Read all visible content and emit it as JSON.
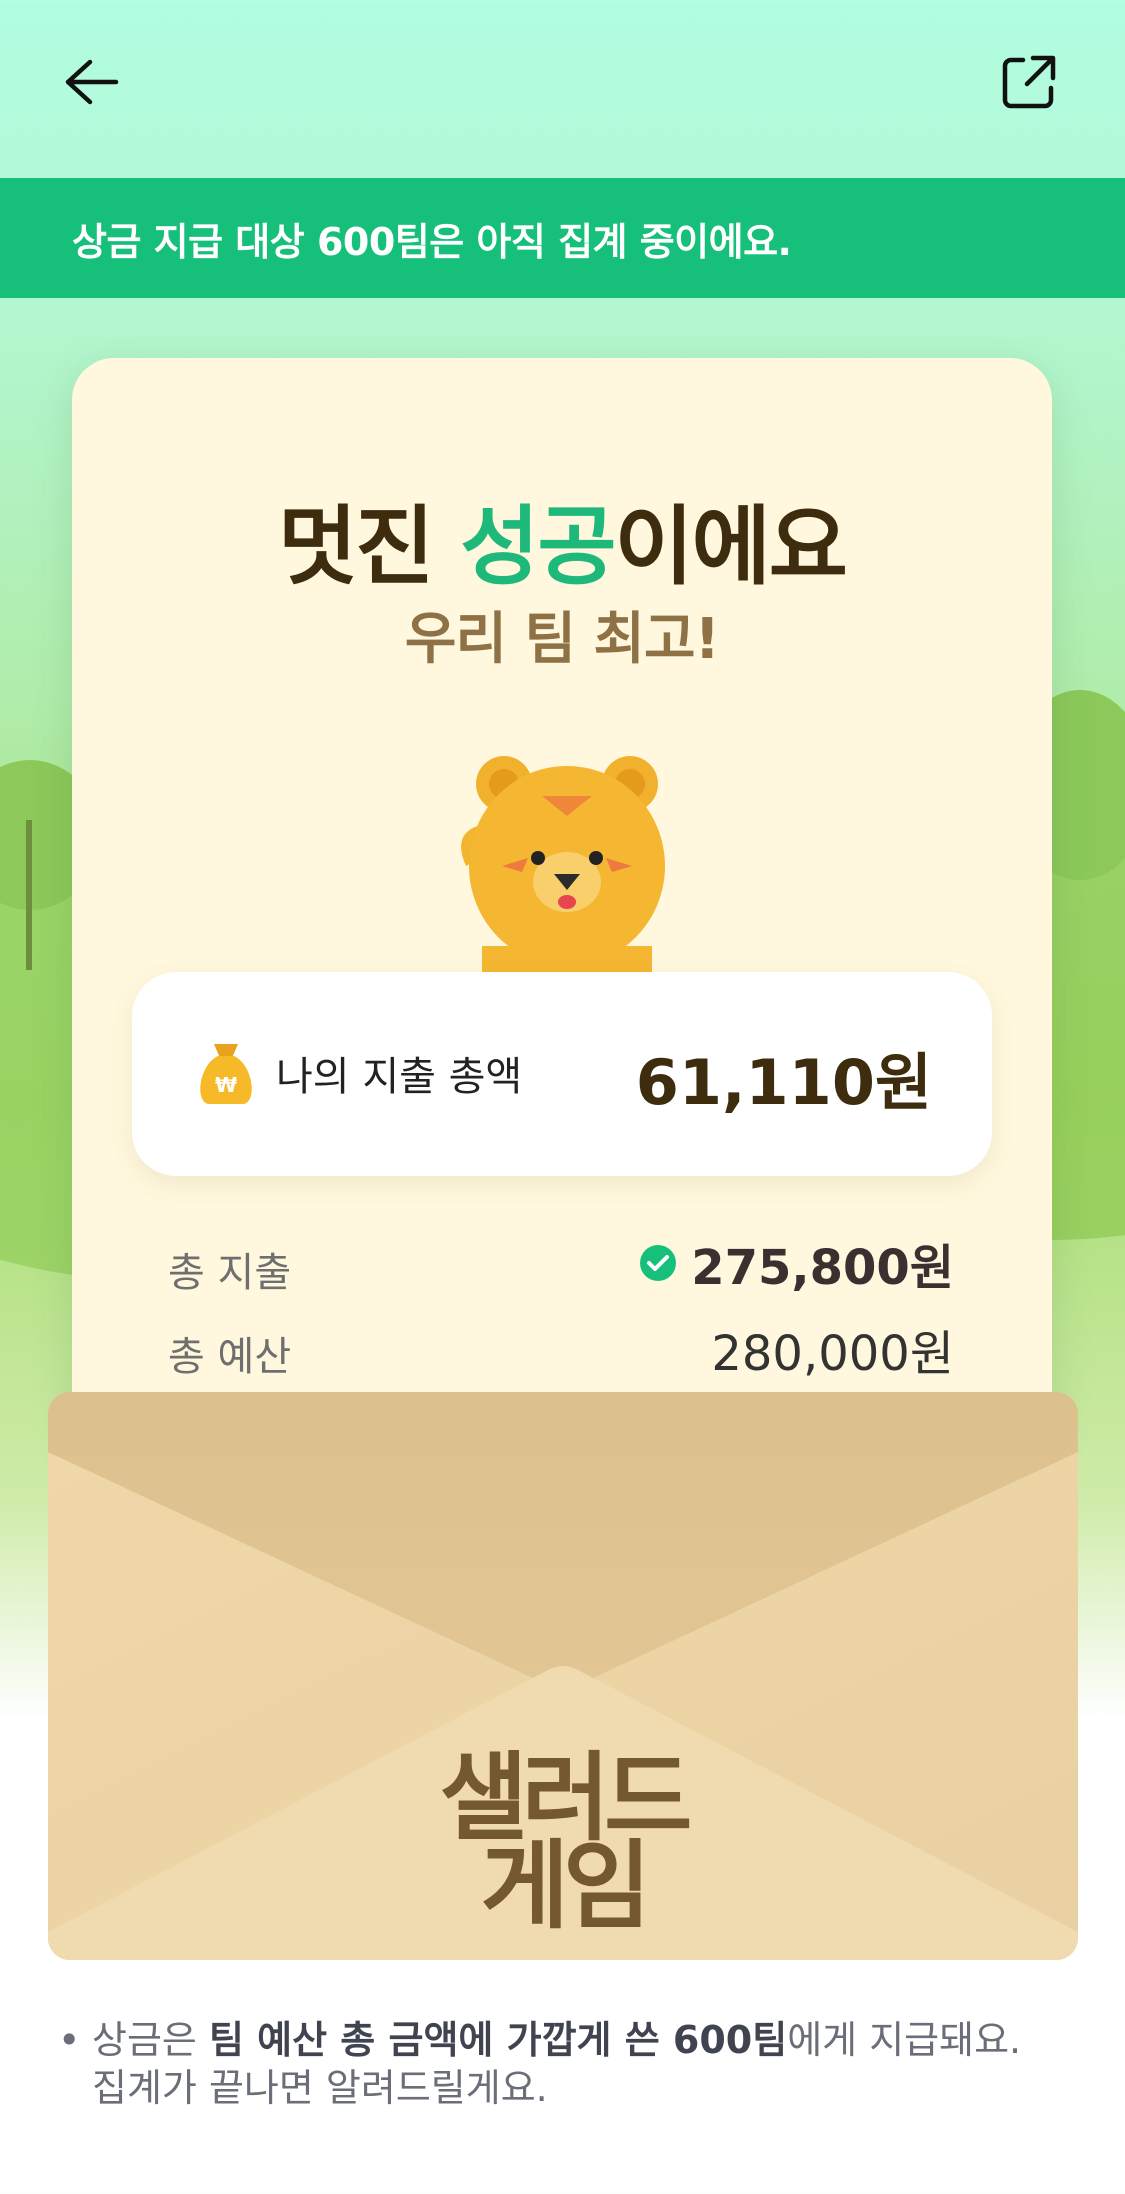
{
  "banner": {
    "text": "상금 지급 대상 600팀은 아직 집계 중이에요."
  },
  "card": {
    "title_prefix": "멋진 ",
    "title_highlight": "성공",
    "title_suffix": "이에요",
    "subtitle": "우리 팀 최고!",
    "my_spending": {
      "label": "나의 지출 총액",
      "value": "61,110원"
    },
    "rows": [
      {
        "label": "총 지출",
        "value": "275,800원"
      },
      {
        "label": "총 예산",
        "value": "280,000원"
      }
    ]
  },
  "envelope": {
    "logo_line1": "샐러드",
    "logo_line2": "게임"
  },
  "note": {
    "part1": "상금은 ",
    "bold": "팀 예산 총 금액에 가깝게 쓴 600팀",
    "part2": "에게 지급돼요.",
    "line2": "집계가 끝나면 알려드릴게요."
  },
  "icons": {
    "back": "arrow-left-icon",
    "share": "share-external-icon",
    "money_bag": "money-bag-icon",
    "check": "check-circle-icon",
    "mascot": "tiger-mascot"
  },
  "colors": {
    "banner": "#16bf7a",
    "highlight": "#1db87a",
    "card": "#fff8de",
    "title": "#3e2c0e",
    "subtitle": "#8e7245",
    "envelope": "#ebcf9c"
  }
}
